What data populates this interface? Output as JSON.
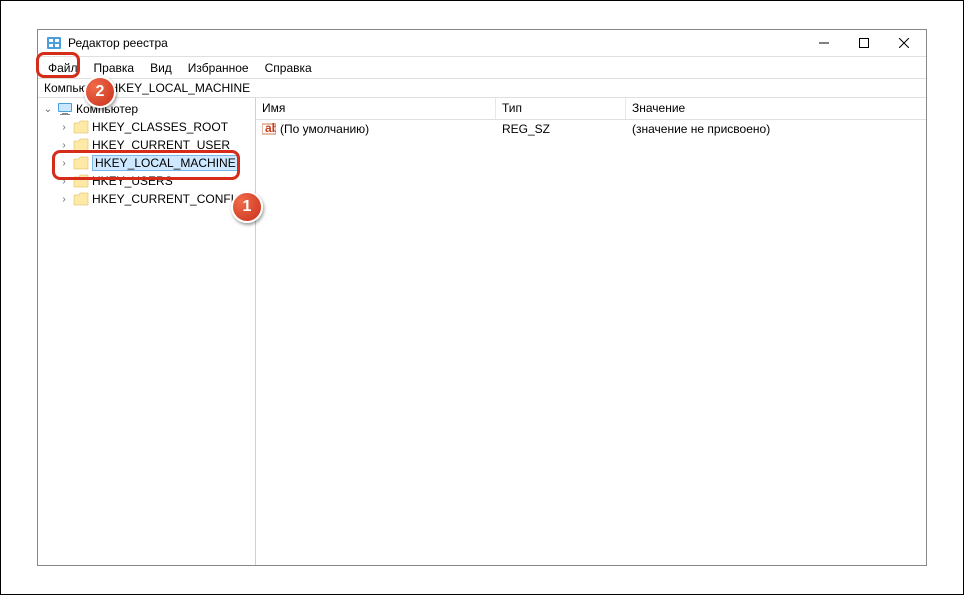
{
  "window": {
    "title": "Редактор реестра"
  },
  "menu": {
    "file": "Файл",
    "edit": "Правка",
    "view": "Вид",
    "favorites": "Избранное",
    "help": "Справка"
  },
  "address": {
    "path": "Компьютер\\HKEY_LOCAL_MACHINE"
  },
  "tree": {
    "root": "Компьютер",
    "items": [
      {
        "label": "HKEY_CLASSES_ROOT"
      },
      {
        "label": "HKEY_CURRENT_USER"
      },
      {
        "label": "HKEY_LOCAL_MACHINE"
      },
      {
        "label": "HKEY_USERS"
      },
      {
        "label": "HKEY_CURRENT_CONFIG"
      }
    ]
  },
  "list": {
    "headers": {
      "name": "Имя",
      "type": "Тип",
      "value": "Значение"
    },
    "rows": [
      {
        "name": "(По умолчанию)",
        "type": "REG_SZ",
        "value": "(значение не присвоено)"
      }
    ]
  },
  "annotations": {
    "badge1": "1",
    "badge2": "2"
  }
}
